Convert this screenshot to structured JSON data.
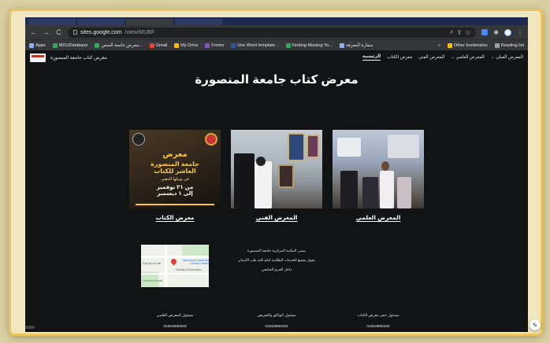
{
  "browser": {
    "url_host": "sites.google.com",
    "url_path": "/view/MUBF",
    "nav_back": "←",
    "nav_forward": "→",
    "nav_reload": "C"
  },
  "bookmarks": {
    "items": [
      {
        "label": "Apps",
        "color": "#8ab4f8"
      },
      {
        "label": "MDUDatabase",
        "color": "#34a853"
      },
      {
        "label": "معرض جامعة المنص...",
        "color": "#34a853"
      },
      {
        "label": "Gmail",
        "color": "#ea4335"
      },
      {
        "label": "My Drive",
        "color": "#fbbc04"
      },
      {
        "label": "Forms",
        "color": "#7e57c2"
      },
      {
        "label": "Use Word template...",
        "color": "#2b579a"
      },
      {
        "label": "Finding Missing Yo...",
        "color": "#34a853"
      },
      {
        "label": "سفارة المعرفة",
        "color": "#8ab4f8"
      }
    ],
    "more": "»",
    "other": "Other bookmarks",
    "reading": "Reading list"
  },
  "site": {
    "header_title": "معرض كتاب جامعة المنصورة",
    "nav": [
      {
        "label": "الرئيسية",
        "active": true
      },
      {
        "label": "معرض الكتاب",
        "active": false
      },
      {
        "label": "المعرض الفني",
        "active": false
      },
      {
        "label": "المعرض العلمي",
        "active": false
      },
      {
        "label": "المعرض القبلي",
        "active": false
      }
    ],
    "main_title": "معرض كتاب جامعة المنصورة",
    "columns": [
      {
        "caption": "المعرض العلمي",
        "kind": "photo"
      },
      {
        "caption": "المعرض الفني",
        "kind": "photo"
      },
      {
        "caption": "معرض الكتاب",
        "kind": "poster"
      }
    ],
    "poster": {
      "line1": "معرض",
      "line2": "جامعة المنصورة",
      "line3": "العاشر للكتاب",
      "line4": "في يوبيلها الذهبي",
      "line5": "من ٢١ نوفمبر",
      "line6": "إلى ١ ديسمبر"
    },
    "location": {
      "lines": [
        "بمبنى المكتبة المركزية جامعة المنصورة",
        "بجوار مجمع الخدمات الطلابية امام كلية طب الأسنان",
        "داخل الحرم الجامعي"
      ]
    },
    "map": {
      "labels": [
        "Mansoura University Central Library",
        "Faculty of Education",
        "Faculty of Law",
        "Oral and Dental"
      ]
    },
    "contacts": [
      {
        "role": "مسئول حجز معرض الكتاب",
        "phone": "01553990200"
      },
      {
        "role": "مسئول الوثائق والتعريض",
        "phone": "01553990202"
      },
      {
        "role": "مسئول المعرض العلمي",
        "phone": "01553990203"
      }
    ]
  }
}
